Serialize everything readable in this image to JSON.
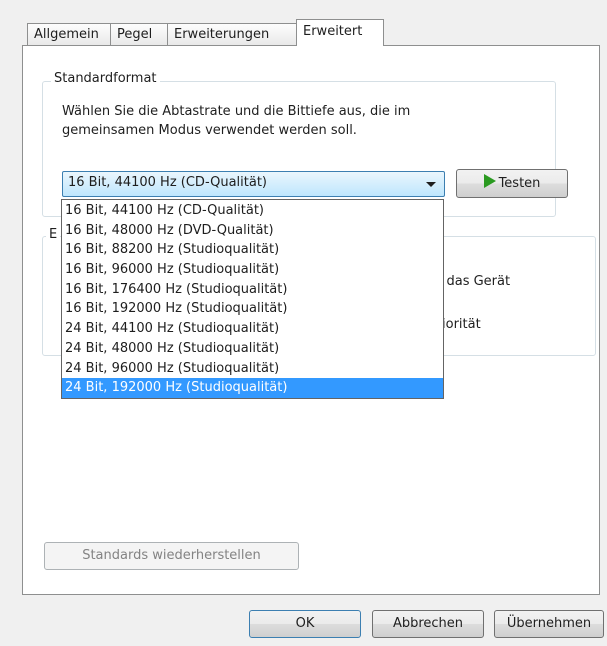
{
  "tabs": [
    "Allgemein",
    "Pegel",
    "Erweiterungen",
    "Erweitert"
  ],
  "standardformat": {
    "title": "Standardformat",
    "description_line1": "Wählen Sie die Abtastrate und die Bittiefe aus, die im",
    "description_line2": "gemeinsamen Modus verwendet werden soll.",
    "selected_value": "16 Bit, 44100 Hz (CD-Qualität)",
    "test_button": "Testen"
  },
  "dropdown_options": [
    "16 Bit, 44100 Hz (CD-Qualität)",
    "16 Bit, 48000 Hz (DVD-Qualität)",
    "16 Bit, 88200 Hz (Studioqualität)",
    "16 Bit, 96000 Hz (Studioqualität)",
    "16 Bit, 176400 Hz (Studioqualität)",
    "16 Bit, 192000 Hz (Studioqualität)",
    "24 Bit, 44100 Hz (Studioqualität)",
    "24 Bit, 48000 Hz (Studioqualität)",
    "24 Bit, 96000 Hz (Studioqualität)",
    "24 Bit, 192000 Hz (Studioqualität)"
  ],
  "dropdown_highlighted_index": 9,
  "exclusive_group": {
    "title_fragment": "E",
    "line1_fragment": "r das Gerät",
    "line2_fragment": "iorität"
  },
  "restore_button": "Standards wiederherstellen",
  "footer": {
    "ok": "OK",
    "cancel": "Abbrechen",
    "apply": "Übernehmen"
  },
  "colors": {
    "highlight": "#3399ff",
    "play_icon": "#2a9a20"
  }
}
